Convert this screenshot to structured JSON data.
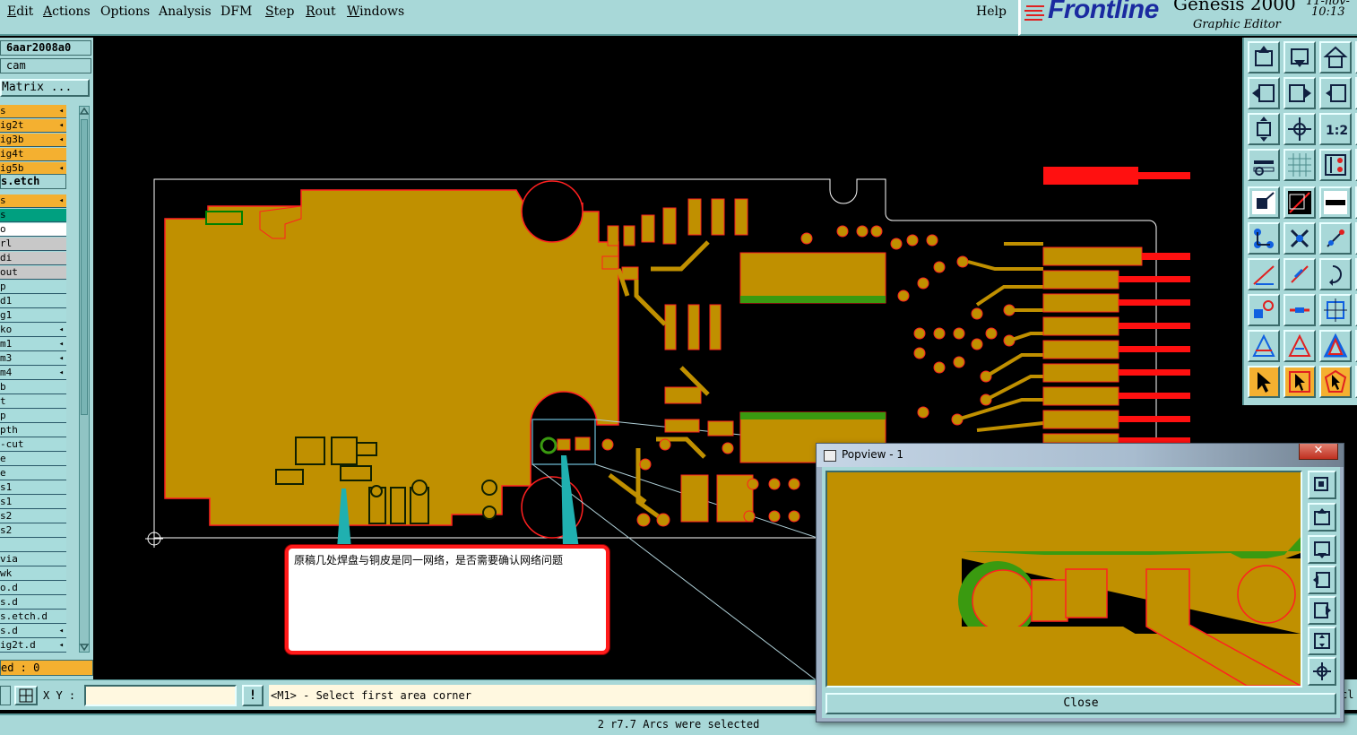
{
  "menu": {
    "items": [
      {
        "label": "Edit",
        "ul": "E",
        "rest": "dit"
      },
      {
        "label": "Actions",
        "ul": "A",
        "rest": "ctions"
      },
      {
        "label": "Options",
        "ul": "",
        "rest": "Options"
      },
      {
        "label": "Analysis",
        "ul": "",
        "rest": "Analysis"
      },
      {
        "label": "DFM",
        "ul": "",
        "rest": "DFM"
      },
      {
        "label": "Step",
        "ul": "S",
        "rest": "tep"
      },
      {
        "label": "Rout",
        "ul": "R",
        "rest": "out"
      },
      {
        "label": "Windows",
        "ul": "W",
        "rest": "indows"
      }
    ],
    "help": "Help"
  },
  "logo": {
    "brand": "Frontline",
    "product": "Genesis 2000",
    "subtitle": "Graphic Editor",
    "date": "11-nov-",
    "time": "10:13"
  },
  "left_panel": {
    "job": "6aar2008a0",
    "user": "cam",
    "matrix_button": "Matrix ...",
    "layers_a": [
      {
        "name": "s",
        "color": "orange",
        "arrow": "◂"
      },
      {
        "name": "ig2t",
        "color": "orange",
        "arrow": "◂"
      },
      {
        "name": "ig3b",
        "color": "orange",
        "arrow": "◂"
      },
      {
        "name": "ig4t",
        "color": "orange",
        "arrow": ""
      },
      {
        "name": "ig5b",
        "color": "orange",
        "arrow": "◂"
      }
    ],
    "etch": "s.etch",
    "layers_b": [
      {
        "name": "s",
        "color": "orange",
        "arrow": "◂"
      },
      {
        "name": "s",
        "color": "teal",
        "arrow": ""
      },
      {
        "name": "o",
        "color": "white",
        "arrow": ""
      },
      {
        "name": "rl",
        "color": "gray",
        "arrow": ""
      },
      {
        "name": "di",
        "color": "gray",
        "arrow": ""
      },
      {
        "name": "out",
        "color": "gray",
        "arrow": ""
      },
      {
        "name": "p",
        "color": "cyan",
        "arrow": ""
      },
      {
        "name": "d1",
        "color": "cyan",
        "arrow": ""
      },
      {
        "name": "g1",
        "color": "cyan",
        "arrow": ""
      },
      {
        "name": "ko",
        "color": "cyan",
        "arrow": "◂"
      },
      {
        "name": "m1",
        "color": "cyan",
        "arrow": "◂"
      },
      {
        "name": "m3",
        "color": "cyan",
        "arrow": "◂"
      },
      {
        "name": "m4",
        "color": "cyan",
        "arrow": "◂"
      },
      {
        "name": "b",
        "color": "cyan",
        "arrow": ""
      },
      {
        "name": "t",
        "color": "cyan",
        "arrow": ""
      },
      {
        "name": "p",
        "color": "cyan",
        "arrow": ""
      },
      {
        "name": "pth",
        "color": "cyan",
        "arrow": ""
      },
      {
        "name": "-cut",
        "color": "cyan",
        "arrow": ""
      },
      {
        "name": "e",
        "color": "cyan",
        "arrow": ""
      },
      {
        "name": "e",
        "color": "cyan",
        "arrow": ""
      },
      {
        "name": "s1",
        "color": "cyan",
        "arrow": ""
      },
      {
        "name": "s1",
        "color": "cyan",
        "arrow": ""
      },
      {
        "name": "s2",
        "color": "cyan",
        "arrow": ""
      },
      {
        "name": "s2",
        "color": "cyan",
        "arrow": ""
      },
      {
        "name": "",
        "color": "cyan",
        "arrow": ""
      },
      {
        "name": "via",
        "color": "cyan",
        "arrow": ""
      },
      {
        "name": "wk",
        "color": "cyan",
        "arrow": ""
      },
      {
        "name": "o.d",
        "color": "cyan",
        "arrow": ""
      },
      {
        "name": "s.d",
        "color": "cyan",
        "arrow": ""
      },
      {
        "name": "s.etch.d",
        "color": "cyan",
        "arrow": ""
      },
      {
        "name": "s.d",
        "color": "cyan",
        "arrow": "◂"
      },
      {
        "name": "ig2t.d",
        "color": "cyan",
        "arrow": "◂"
      }
    ],
    "selected": "ed : 0"
  },
  "command": {
    "xy_label": "X Y :",
    "xy_value": "",
    "bang": "!",
    "message": "<M1> - Select first area corner",
    "right_fragment": "cl"
  },
  "status": "2 r7.7 Arcs were selected",
  "popview": {
    "title": "Popview - 1",
    "close_x": "✕",
    "close_button": "Close"
  },
  "annotation": {
    "text": "原稿几处焊盘与铜皮是同一网络，是否需要确认网络问题"
  },
  "colors": {
    "copper": "#c09000",
    "green": "#3a9a10",
    "outline": "#ff2020",
    "panel": "#a8d8d8",
    "selected_orange": "#f4b030"
  }
}
